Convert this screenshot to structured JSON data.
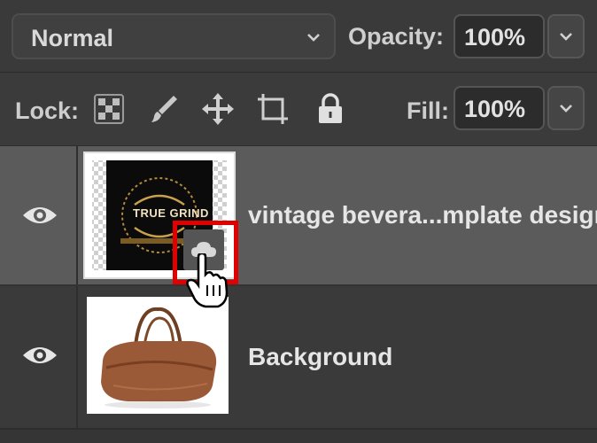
{
  "blend": {
    "mode": "Normal"
  },
  "opacity": {
    "label": "Opacity:",
    "value": "100%"
  },
  "lock": {
    "label": "Lock:",
    "icons": [
      "lock-transparent-pixels-icon",
      "lock-image-pixels-icon",
      "lock-position-icon",
      "lock-artboard-icon",
      "lock-all-icon"
    ]
  },
  "fill": {
    "label": "Fill:",
    "value": "100%"
  },
  "layers": [
    {
      "name": "vintage bevera...mplate design",
      "visible": true,
      "selected": true,
      "smart_object": "cloud-library-icon",
      "thumb_text": "TRUE GRIND"
    },
    {
      "name": "Background",
      "visible": true,
      "selected": false
    }
  ],
  "colors": {
    "panel": "#3a3a3a",
    "selected_row": "#5b5b5b",
    "highlight_box": "#e10000"
  }
}
